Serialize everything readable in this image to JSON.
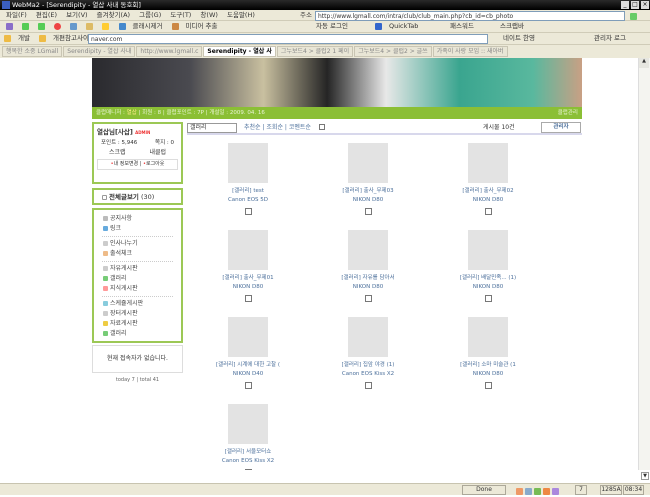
{
  "window": {
    "title": "WebMa2 - [Serendipity - 열삽 사내 동호회]",
    "buttons": [
      "_",
      "□",
      "×"
    ]
  },
  "menu": [
    "파일(F)",
    "편집(E)",
    "보기(V)",
    "즐겨찾기(A)",
    "그룹(G)",
    "도구(T)",
    "창(W)",
    "도움말(H)"
  ],
  "address": {
    "label": "주소",
    "url": "http://www.lgmall.com/intra/club/club_main.php?cb_id=cb_photo"
  },
  "toolbar": {
    "capture": "클래시제거",
    "media": "미디어 추출",
    "autologin": "자동 로그인",
    "quicktab": "QuickTab",
    "password": "패스워드",
    "scrap": "스크랩바"
  },
  "links": {
    "items": [
      "개발",
      "개편참고사이"
    ],
    "search_value": "naver.com",
    "translate": "네이트 한영",
    "admin": "관리자 로그"
  },
  "tabs": [
    {
      "label": "행복한 소중 LGmall",
      "active": false
    },
    {
      "label": "Serendipity - 열삽 사내",
      "active": false
    },
    {
      "label": "http://www.lgmall.c",
      "active": false
    },
    {
      "label": "Serendipity - 열삽 사",
      "active": true
    },
    {
      "label": "그누보드4 > 클럽2 1 페이",
      "active": false
    },
    {
      "label": "그누보드4 > 클럽2 > 글쓰",
      "active": false
    },
    {
      "label": "가족이 사랑 모임 :: 새아버",
      "active": false
    }
  ],
  "clubbar": {
    "manager_label": "클럽매니저 :",
    "manager": "열삽",
    "members": "회원 : 8",
    "points": "클럽포인트 : 7P",
    "opened": "개설일 : 2009. 04. 16",
    "manage": "클럽관리"
  },
  "profile": {
    "name": "열삽님[사삽]",
    "badge": "ADMIN",
    "points": "포인트 : 5,946",
    "notes": "쪽지 : 0",
    "scrap": "스크랩",
    "myclub": "내클럽",
    "edit": "내 정보변경",
    "logout": "로그아웃"
  },
  "all_posts": {
    "label": "전체글보기",
    "count": "(30)"
  },
  "boards": [
    [
      "공지사항",
      "링크"
    ],
    [
      "인사나누기",
      "출석체크"
    ],
    [
      "자유게시판",
      "갤러리",
      "지식게시판"
    ],
    [
      "스케쥴게시판",
      "장터게시판",
      "자료게시판",
      "갤러리"
    ]
  ],
  "online": "현재 접속자가 없습니다.",
  "visits": "today 7 | total 41",
  "filter": {
    "select": "갤러리",
    "sort": [
      "추천순",
      "조회순",
      "코멘트순"
    ],
    "count": "게시물 10건",
    "admin_btn": "관리자"
  },
  "gallery": [
    {
      "title": "[갤러리] test",
      "camera": "Canon EOS 5D"
    },
    {
      "title": "[갤러리] 출사_무제03",
      "camera": "NIKON D80"
    },
    {
      "title": "[갤러리] 출사_무제02",
      "camera": "NIKON D80"
    },
    {
      "title": "[갤러리] 출사_무제01",
      "camera": "NIKON D80"
    },
    {
      "title": "[갤러리] 자유를 담아서",
      "camera": "NIKON D80"
    },
    {
      "title": "[갤러리] 배달민족... (1)",
      "camera": "NIKON D80"
    },
    {
      "title": "[갤러리] 시계에 대한 고찰 (",
      "camera": "NIKON D40"
    },
    {
      "title": "[갤러리] 집앞 야경 (1)",
      "camera": "Canon EOS Kiss X2"
    },
    {
      "title": "[갤러리] 소마 미술관 (1",
      "camera": "NIKON D80"
    },
    {
      "title": "[갤러리] 서울모터쇼",
      "camera": "Canon EOS Kiss X2"
    }
  ],
  "status": {
    "text": "Done",
    "count": "7",
    "mem": "1285A",
    "time": "08:34"
  },
  "colors": {
    "accent": "#8bbf35",
    "link": "#4a6e9a"
  }
}
